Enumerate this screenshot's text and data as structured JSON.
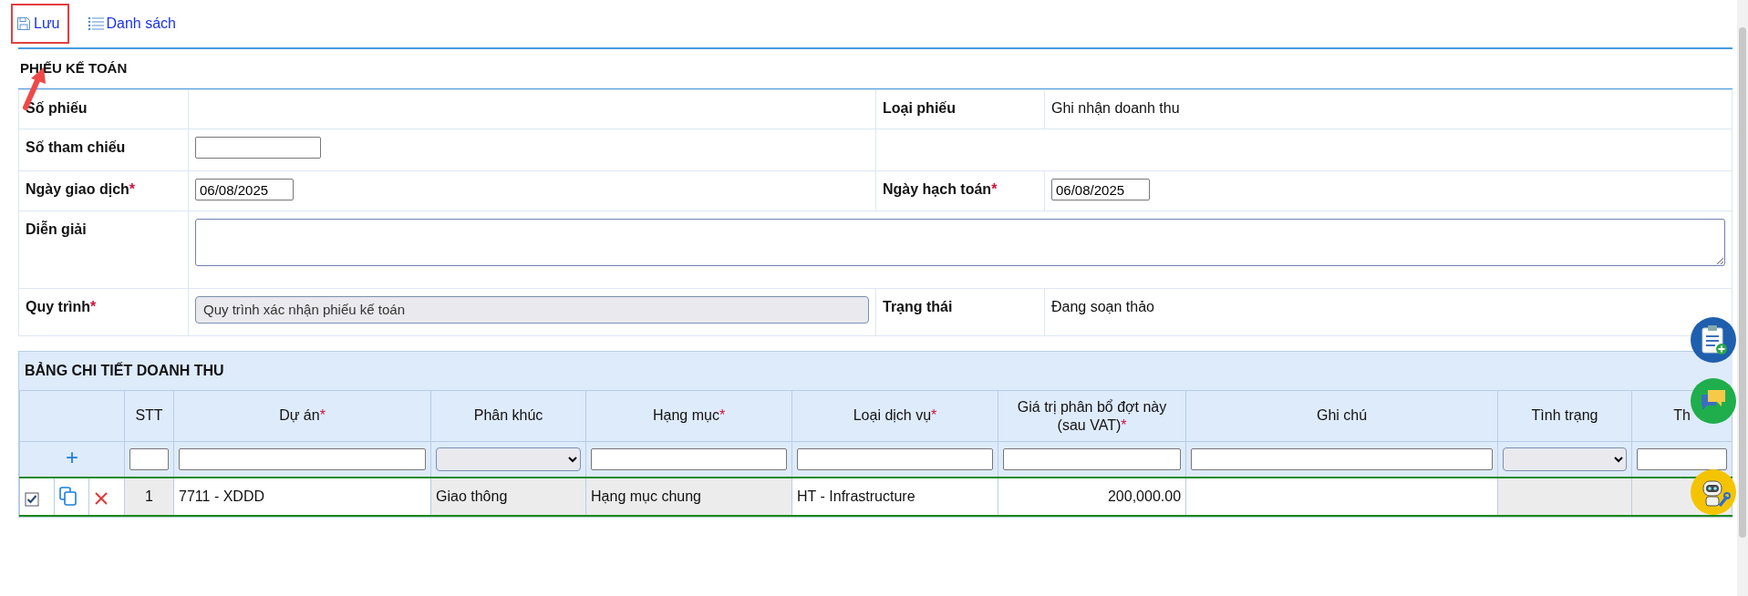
{
  "toolbar": [
    {
      "kind": "save",
      "label": "Lưu",
      "highlighted": true
    },
    {
      "kind": "list",
      "label": "Danh sách",
      "highlighted": false
    }
  ],
  "pointer_arrow": true,
  "form": {
    "title": "PHIẾU KẾ TOÁN",
    "rows": [
      {
        "fields": [
          {
            "label": "Số phiếu",
            "kind": "text"
          },
          {
            "label": "Loại phiếu",
            "kind": "text",
            "value": "Ghi nhận doanh thu"
          }
        ]
      },
      {
        "fields": [
          {
            "label": "Số tham chiếu",
            "kind": "input"
          }
        ]
      },
      {
        "fields": [
          {
            "label": "Ngày giao dịch",
            "mark": "*",
            "kind": "date",
            "value": "06/08/2025"
          },
          {
            "label": "Ngày hạch toán",
            "mark": "*",
            "kind": "date",
            "value": "06/08/2025"
          }
        ]
      },
      {
        "fields": [
          {
            "label": "Diễn giải",
            "kind": "textarea"
          }
        ]
      },
      {
        "fields": [
          {
            "label": "Quy trình",
            "mark": "*",
            "kind": "select",
            "value": "Quy trình xác nhận phiếu kế toán"
          },
          {
            "label": "Trạng thái",
            "kind": "text",
            "value": "Đang soạn thảo"
          }
        ]
      }
    ]
  },
  "detail": {
    "title": "BẢNG CHI TIẾT DOANH THU",
    "add_label": "+",
    "columns": [
      {
        "label": "STT",
        "filter_dropdown": false,
        "readonly": true,
        "centered": true,
        "numeric": false
      },
      {
        "label": "Dự án",
        "mark": "*",
        "filter_dropdown": false,
        "readonly": false,
        "centered": false,
        "numeric": false
      },
      {
        "label": "Phân khúc",
        "filter_dropdown": true,
        "readonly": true,
        "centered": false,
        "numeric": false
      },
      {
        "label": "Hạng mục",
        "mark": "*",
        "filter_dropdown": false,
        "readonly": true,
        "centered": false,
        "numeric": false
      },
      {
        "label": "Loại dịch vụ",
        "mark": "*",
        "filter_dropdown": false,
        "readonly": false,
        "centered": false,
        "numeric": false
      },
      {
        "label": "Giá trị phân bổ đợt này (sau VAT)",
        "mark": "*",
        "filter_dropdown": false,
        "readonly": false,
        "numeric": true
      },
      {
        "label": "Ghi chú",
        "filter_dropdown": false,
        "readonly": false
      },
      {
        "label": "Tình trạng",
        "filter_dropdown": true,
        "readonly": true
      },
      {
        "label": "Th",
        "filter_dropdown": false,
        "readonly": true
      }
    ],
    "rows": [
      {
        "checked": true,
        "cells": [
          "1",
          "7711 - XDDD",
          "Giao thông",
          "Hạng mục chung",
          "HT - Infrastructure",
          "200,000.00"
        ]
      }
    ]
  },
  "floating_buttons": [
    {
      "kind": "clipboard",
      "color": "#1f5fae"
    },
    {
      "kind": "chat",
      "color": "#1fae4b"
    },
    {
      "kind": "robot",
      "color": "#f5c400"
    }
  ]
}
